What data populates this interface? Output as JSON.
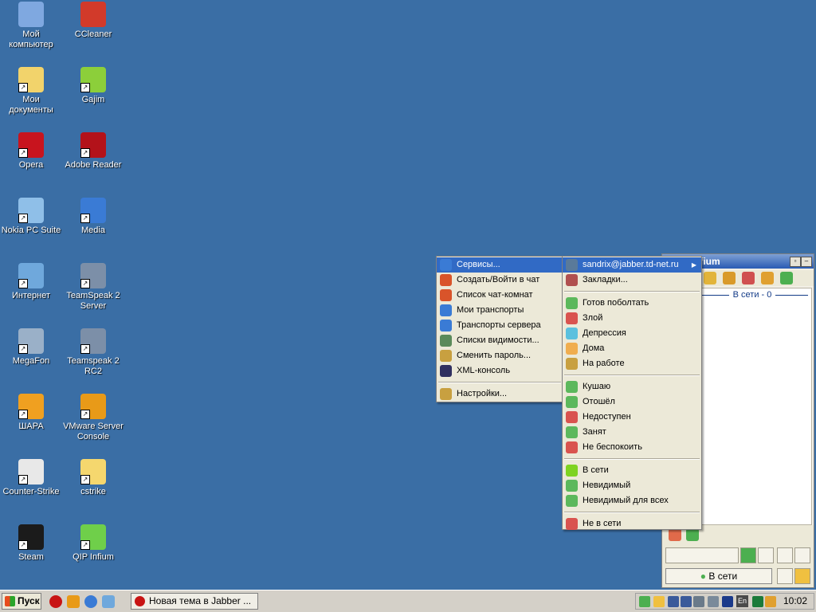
{
  "desktop_icons": [
    {
      "label": "Мой компьютер",
      "color": "#7fa8e0"
    },
    {
      "label": "CCleaner",
      "color": "#d23a2a"
    },
    {
      "label": "Мои документы",
      "color": "#f2d36b"
    },
    {
      "label": "Gajim",
      "color": "#8ccf3a"
    },
    {
      "label": "Opera",
      "color": "#c8141e"
    },
    {
      "label": "Adobe Reader",
      "color": "#b3121a"
    },
    {
      "label": "Nokia PC Suite",
      "color": "#8fbfe8"
    },
    {
      "label": "Media",
      "color": "#3a7bd5"
    },
    {
      "label": "Интернет",
      "color": "#6fa8dc"
    },
    {
      "label": "TeamSpeak 2 Server",
      "color": "#7c8fa8"
    },
    {
      "label": "MegaFon",
      "color": "#9ab0c8"
    },
    {
      "label": "Teamspeak 2 RC2",
      "color": "#7c8fa8"
    },
    {
      "label": "ШАРА",
      "color": "#f0a020"
    },
    {
      "label": "VMware Server Console",
      "color": "#e89a18"
    },
    {
      "label": "Counter-Strike",
      "color": "#e8e8e8"
    },
    {
      "label": "cstrike",
      "color": "#f5d76e"
    },
    {
      "label": "Steam",
      "color": "#1b1b1b"
    },
    {
      "label": "QIP Infium",
      "color": "#6fcf4a"
    }
  ],
  "qip_window": {
    "title": "nfium",
    "group_label": "В сети - 0",
    "status_label": "В сети"
  },
  "main_menu": {
    "items": [
      {
        "label": "Сервисы...",
        "highlighted": true,
        "color": "#3a7bd5"
      },
      {
        "label": "Создать/Войти в чат",
        "color": "#d9542a"
      },
      {
        "label": "Список чат-комнат",
        "color": "#d9542a"
      },
      {
        "label": "Мои транспорты",
        "color": "#3a7bd5"
      },
      {
        "label": "Транспорты сервера",
        "color": "#3a7bd5"
      },
      {
        "label": "Списки видимости...",
        "color": "#5a8a5a"
      },
      {
        "label": "Сменить пароль...",
        "color": "#c8a040"
      },
      {
        "label": "XML-консоль",
        "color": "#303060"
      }
    ],
    "settings_label": "Настройки..."
  },
  "status_menu": {
    "account": "sandrix@jabber.td-net.ru",
    "bookmarks": "Закладки...",
    "group1": [
      {
        "label": "Готов поболтать",
        "color": "#5cb85c"
      },
      {
        "label": "Злой",
        "color": "#d9534f"
      },
      {
        "label": "Депрессия",
        "color": "#5bc0de"
      },
      {
        "label": "Дома",
        "color": "#f0ad4e"
      },
      {
        "label": "На работе",
        "color": "#c8a040"
      }
    ],
    "group2": [
      {
        "label": "Кушаю",
        "color": "#5cb85c"
      },
      {
        "label": "Отошёл",
        "color": "#5cb85c"
      },
      {
        "label": "Недоступен",
        "color": "#d9534f"
      },
      {
        "label": "Занят",
        "color": "#5cb85c"
      },
      {
        "label": "Не беспокоить",
        "color": "#d9534f"
      }
    ],
    "group3": [
      {
        "label": "В сети",
        "color": "#7ed321"
      },
      {
        "label": "Невидимый",
        "color": "#5cb85c"
      },
      {
        "label": "Невидимый для всех",
        "color": "#5cb85c"
      }
    ],
    "offline": "Не в сети"
  },
  "taskbar": {
    "start_label": "Пуск",
    "task_label": "Новая тема в Jabber ...",
    "lang": "En",
    "clock": "10:02"
  }
}
